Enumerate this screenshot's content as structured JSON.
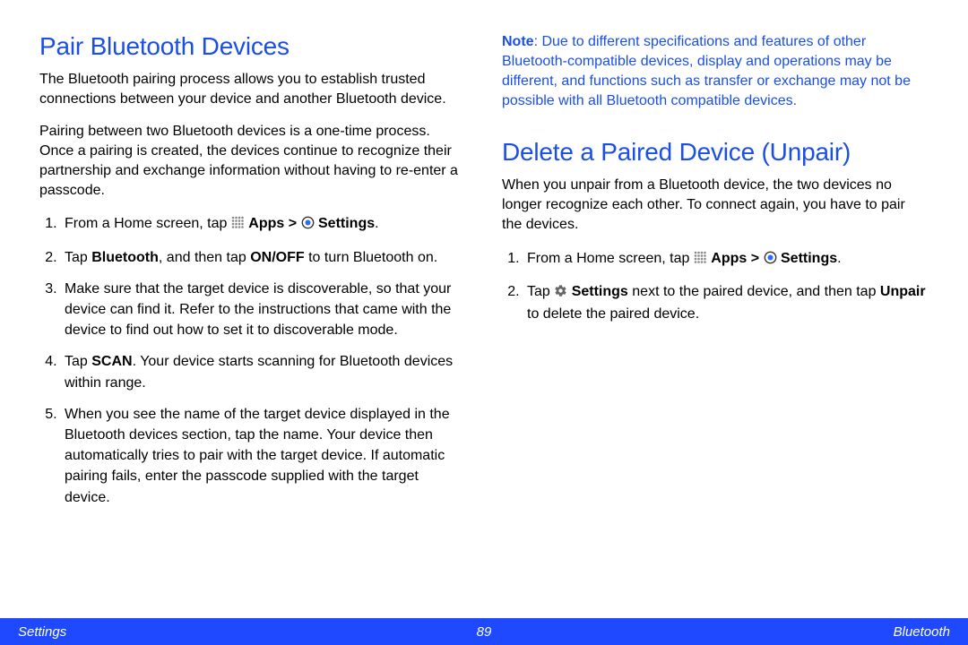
{
  "left": {
    "heading": "Pair Bluetooth Devices",
    "p1": "The Bluetooth pairing process allows you to establish trusted connections between your device and another Bluetooth device.",
    "p2": "Pairing between two Bluetooth devices is a one-time process. Once a pairing is created, the devices continue to recognize their partnership and exchange information without having to re-enter a passcode.",
    "step1_pre": "From a Home screen, tap ",
    "apps": "Apps",
    "gt": " > ",
    "settings_bold": "Settings",
    "step1_post": ".",
    "step2_pre": "Tap ",
    "bluetooth_bold": "Bluetooth",
    "step2_mid": ", and then tap ",
    "onoff_bold": "ON/OFF",
    "step2_post": " to turn Bluetooth on.",
    "step3": "Make sure that the target device is discoverable, so that your device can find it. Refer to the instructions that came with the device to find out how to set it to discoverable mode.",
    "step4_pre": "Tap ",
    "scan_bold": "SCAN",
    "step4_post": ". Your device starts scanning for Bluetooth devices within range.",
    "step5": "When you see the name of the target device displayed in the Bluetooth devices section, tap the name. Your device then automatically tries to pair with the target device. If automatic pairing fails, enter the passcode supplied with the target device."
  },
  "right": {
    "note_label": "Note",
    "note_text": ": Due to different specifications and features of other Bluetooth-compatible devices, display and operations may be different, and functions such as transfer or exchange may not be possible with all Bluetooth compatible devices.",
    "heading": "Delete a Paired Device (Unpair)",
    "p1": "When you unpair from a Bluetooth device, the two devices no longer recognize each other. To connect again, you have to pair the devices.",
    "step1_pre": "From a Home screen, tap ",
    "apps": "Apps",
    "gt": " > ",
    "settings_bold": "Settings",
    "step1_post": ".",
    "step2_pre": "Tap ",
    "settings_bold2": "Settings",
    "step2_mid": " next to the paired device, and then tap ",
    "unpair_bold": "Unpair",
    "step2_post": " to delete the paired device."
  },
  "footer": {
    "left": "Settings",
    "center": "89",
    "right": "Bluetooth"
  }
}
